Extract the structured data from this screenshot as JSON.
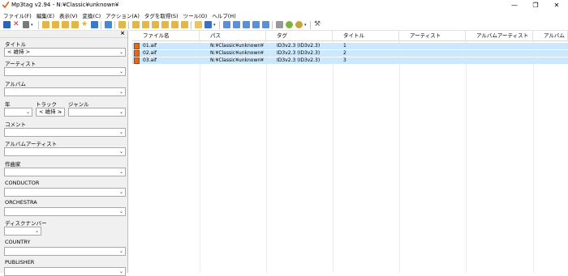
{
  "window": {
    "title": "Mp3tag v2.94  -  N:¥Classic¥unknown¥",
    "minimize_glyph": "—",
    "maximize_glyph": "❐",
    "close_glyph": "✕"
  },
  "menu": [
    "ファイル(F)",
    "編集(E)",
    "表示(V)",
    "変換(C)",
    "アクション(A)",
    "タグを取得(S)",
    "ツール(O)",
    "ヘルプ(H)"
  ],
  "toolbar": {
    "icons": [
      "save-icon",
      "remove-tag-icon",
      "undo-icon",
      "change-directory-icon",
      "add-directory-icon",
      "favorite-icon",
      "refresh-icon",
      "select-all-icon",
      "playlist-icon",
      "filename-tag-icon",
      "tag-filename-icon",
      "text-file-tag-icon",
      "tag-tag-icon",
      "actions-icon",
      "auto-numbering-icon",
      "export-icon",
      "web-source-icon",
      "tools-icon"
    ],
    "accent": "#f2b530"
  },
  "panel": {
    "close_glyph": "×",
    "fields": [
      {
        "label": "タイトル",
        "value": "< 維持 >"
      },
      {
        "label": "アーティスト",
        "value": ""
      },
      {
        "label": "アルバム",
        "value": ""
      },
      {
        "label": "年",
        "value": ""
      },
      {
        "label": "トラック",
        "value": "< 維持 >"
      },
      {
        "label": "ジャンル",
        "value": ""
      },
      {
        "label": "コメント",
        "value": ""
      },
      {
        "label": "アルバムアーティスト",
        "value": ""
      },
      {
        "label": "作曲家",
        "value": ""
      },
      {
        "label": "CONDUCTOR",
        "value": ""
      },
      {
        "label": "ORCHESTRA",
        "value": ""
      },
      {
        "label": "ディスクナンバー",
        "value": ""
      },
      {
        "label": "COUNTRY",
        "value": ""
      },
      {
        "label": "PUBLISHER",
        "value": ""
      }
    ],
    "dropdown_glyph": "⌄"
  },
  "grid": {
    "columns": [
      "ファイル名",
      "パス",
      "タグ",
      "タイトル",
      "アーティスト",
      "アルバムアーティスト",
      "アルバム"
    ],
    "rows": [
      {
        "file": "01.aif",
        "path": "N:¥Classic¥unknown¥",
        "tag": "ID3v2.3 (ID3v2.3)",
        "title": "1"
      },
      {
        "file": "02.aif",
        "path": "N:¥Classic¥unknown¥",
        "tag": "ID3v2.3 (ID3v2.3)",
        "title": "2"
      },
      {
        "file": "03.aif",
        "path": "N:¥Classic¥unknown¥",
        "tag": "ID3v2.3 (ID3v2.3)",
        "title": "3"
      }
    ],
    "selection_color": "#cce8ff"
  }
}
